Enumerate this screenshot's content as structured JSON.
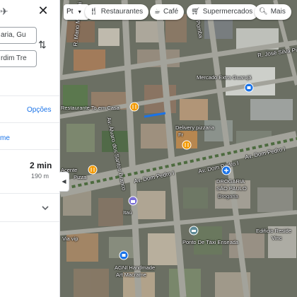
{
  "panel": {
    "origin_value": "aria, Gu",
    "destination_value": "rdim Tre",
    "options_label": "Opções",
    "left_link_label": "me",
    "route_time": "2 min",
    "route_distance": "190 m"
  },
  "chips": {
    "language": "Pt",
    "restaurants": "Restaurantes",
    "cafe": "Café",
    "supermarkets": "Supermercados",
    "more": "Mais"
  },
  "map": {
    "streets": {
      "r_jose_silva": "R. José Silva Pi",
      "av_dom_pedro_1": "Av. Dom Pedro I",
      "av_dom_pedro_2": "Av. Dom Pedro I",
      "av_dom_pedro_3": "Av. Dom Pedro I",
      "av_alvaro": "Av. Álvaro dos Santos Branco",
      "r_left": "R. Mano Mauriani",
      "r_top": "Pomba"
    },
    "pois": {
      "mercado": "Mercado Extra Guarujá",
      "restaurante": "Restaurante To em Casa",
      "delivery_line1": "Delivery pizzaria",
      "delivery_line2": "Fr",
      "acente": "Acente",
      "pizza": "Pizza",
      "drogaria_line1": "DROGARIA",
      "drogaria_line2": "SÃO PAULO",
      "drogaria_line3": "Drogaria",
      "itau": "Itaú",
      "edificio": "Edifício Reside",
      "edificio_line2": "Vinc",
      "ponto_taxi": "Ponto De Táxi Enseada",
      "agni_line1": "AGNI Handmade",
      "agni_line2": "Art Macrame",
      "vip": "Via vip"
    }
  },
  "colors": {
    "link_blue": "#1a73e8",
    "pin_orange": "#f29900",
    "pin_blue": "#1a73e8",
    "road_gray": "#9a9a93"
  }
}
